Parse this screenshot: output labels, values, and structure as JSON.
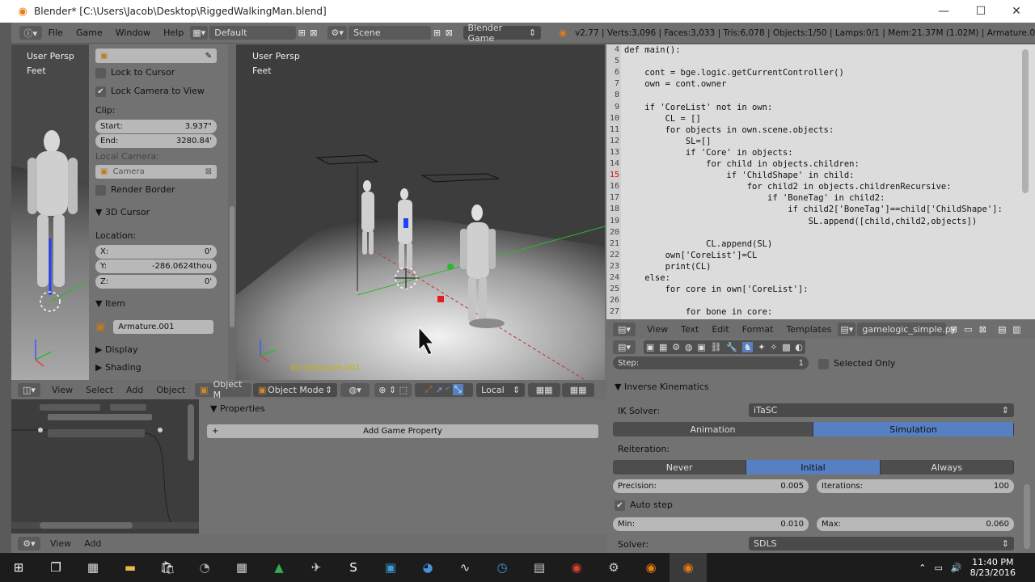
{
  "window": {
    "title": "Blender* [C:\\Users\\Jacob\\Desktop\\RiggedWalkingMan.blend]",
    "minimize": "—",
    "maximize": "☐",
    "close": "✕"
  },
  "infobar": {
    "menus": [
      "File",
      "Game",
      "Window",
      "Help"
    ],
    "layout": "Default",
    "scene": "Scene",
    "engine": "Blender Game",
    "stats": "v2.77 | Verts:3,096 | Faces:3,033 | Tris:6,078 | Objects:1/50 | Lamps:0/1 | Mem:21.37M (1.02M) | Armature.0"
  },
  "left_view": {
    "persp": "User Persp",
    "units": "Feet"
  },
  "npanel": {
    "lock_to_cursor": "Lock to Cursor",
    "lock_camera": "Lock Camera to View",
    "clip": "Clip:",
    "start_label": "Start:",
    "start_value": "3.937\"",
    "end_label": "End:",
    "end_value": "3280.84'",
    "local_camera": "Local Camera:",
    "camera": "Camera",
    "render_border": "Render Border",
    "cursor_section": "3D Cursor",
    "location": "Location:",
    "x_label": "X:",
    "x_value": "0'",
    "y_label": "Y:",
    "y_value": "-286.0624thou",
    "z_label": "Z:",
    "z_value": "0'",
    "item_section": "Item",
    "item_name": "Armature.001",
    "display_section": "Display",
    "shading_section": "Shading"
  },
  "center_view": {
    "persp": "User Persp",
    "units": "Feet",
    "object_label": "(0) Armature.001"
  },
  "view_header": {
    "menus": [
      "View",
      "Select",
      "Add",
      "Object"
    ],
    "object_trunc": "Object M",
    "mode": "Object Mode",
    "orientation": "Local"
  },
  "node_editor": {
    "props_title": "Properties",
    "add_game_property": "Add Game Property"
  },
  "bottom_header": {
    "menus": [
      "View",
      "Add"
    ]
  },
  "code": {
    "lines": [
      {
        "n": "4",
        "t": "def main():"
      },
      {
        "n": "5",
        "t": ""
      },
      {
        "n": "6",
        "t": "    cont = bge.logic.getCurrentController()"
      },
      {
        "n": "7",
        "t": "    own = cont.owner"
      },
      {
        "n": "8",
        "t": ""
      },
      {
        "n": "9",
        "t": "    if 'CoreList' not in own:"
      },
      {
        "n": "10",
        "t": "        CL = []"
      },
      {
        "n": "11",
        "t": "        for objects in own.scene.objects:"
      },
      {
        "n": "12",
        "t": "            SL=[]"
      },
      {
        "n": "13",
        "t": "            if 'Core' in objects:"
      },
      {
        "n": "14",
        "t": "                for child in objects.children:"
      },
      {
        "n": "15",
        "t": "                    if 'ChildShape' in child:"
      },
      {
        "n": "16",
        "t": "                        for child2 in objects.childrenRecursive:"
      },
      {
        "n": "17",
        "t": "                            if 'BoneTag' in child2:"
      },
      {
        "n": "18",
        "t": "                                if child2['BoneTag']==child['ChildShape']:"
      },
      {
        "n": "19",
        "t": "                                    SL.append([child,child2,objects])"
      },
      {
        "n": "20",
        "t": ""
      },
      {
        "n": "21",
        "t": "                CL.append(SL)"
      },
      {
        "n": "22",
        "t": "        own['CoreList']=CL"
      },
      {
        "n": "23",
        "t": "        print(CL)"
      },
      {
        "n": "24",
        "t": "    else:"
      },
      {
        "n": "25",
        "t": "        for core in own['CoreList']:"
      },
      {
        "n": "26",
        "t": ""
      },
      {
        "n": "27",
        "t": "            for bone in core:"
      }
    ]
  },
  "text_header": {
    "menus": [
      "View",
      "Text",
      "Edit",
      "Format",
      "Templates"
    ],
    "filename": "gamelogic_simple.py"
  },
  "rprops": {
    "step_label": "Step:",
    "step_value": "1",
    "selected_only": "Selected Only",
    "ik_section": "Inverse Kinematics",
    "ik_solver_label": "IK Solver:",
    "ik_solver": "iTaSC",
    "animation": "Animation",
    "simulation": "Simulation",
    "reiteration": "Reiteration:",
    "never": "Never",
    "initial": "Initial",
    "always": "Always",
    "precision_label": "Precision:",
    "precision": "0.005",
    "iterations_label": "Iterations:",
    "iterations": "100",
    "auto_step": "Auto step",
    "min_label": "Min:",
    "min": "0.010",
    "max_label": "Max:",
    "max": "0.060",
    "solver_label": "Solver:",
    "solver": "SDLS"
  },
  "taskbar": {
    "time": "11:40 PM",
    "date": "8/23/2016"
  },
  "colors": {
    "accent": "#5680c2",
    "selected_name": "#c8b400"
  }
}
